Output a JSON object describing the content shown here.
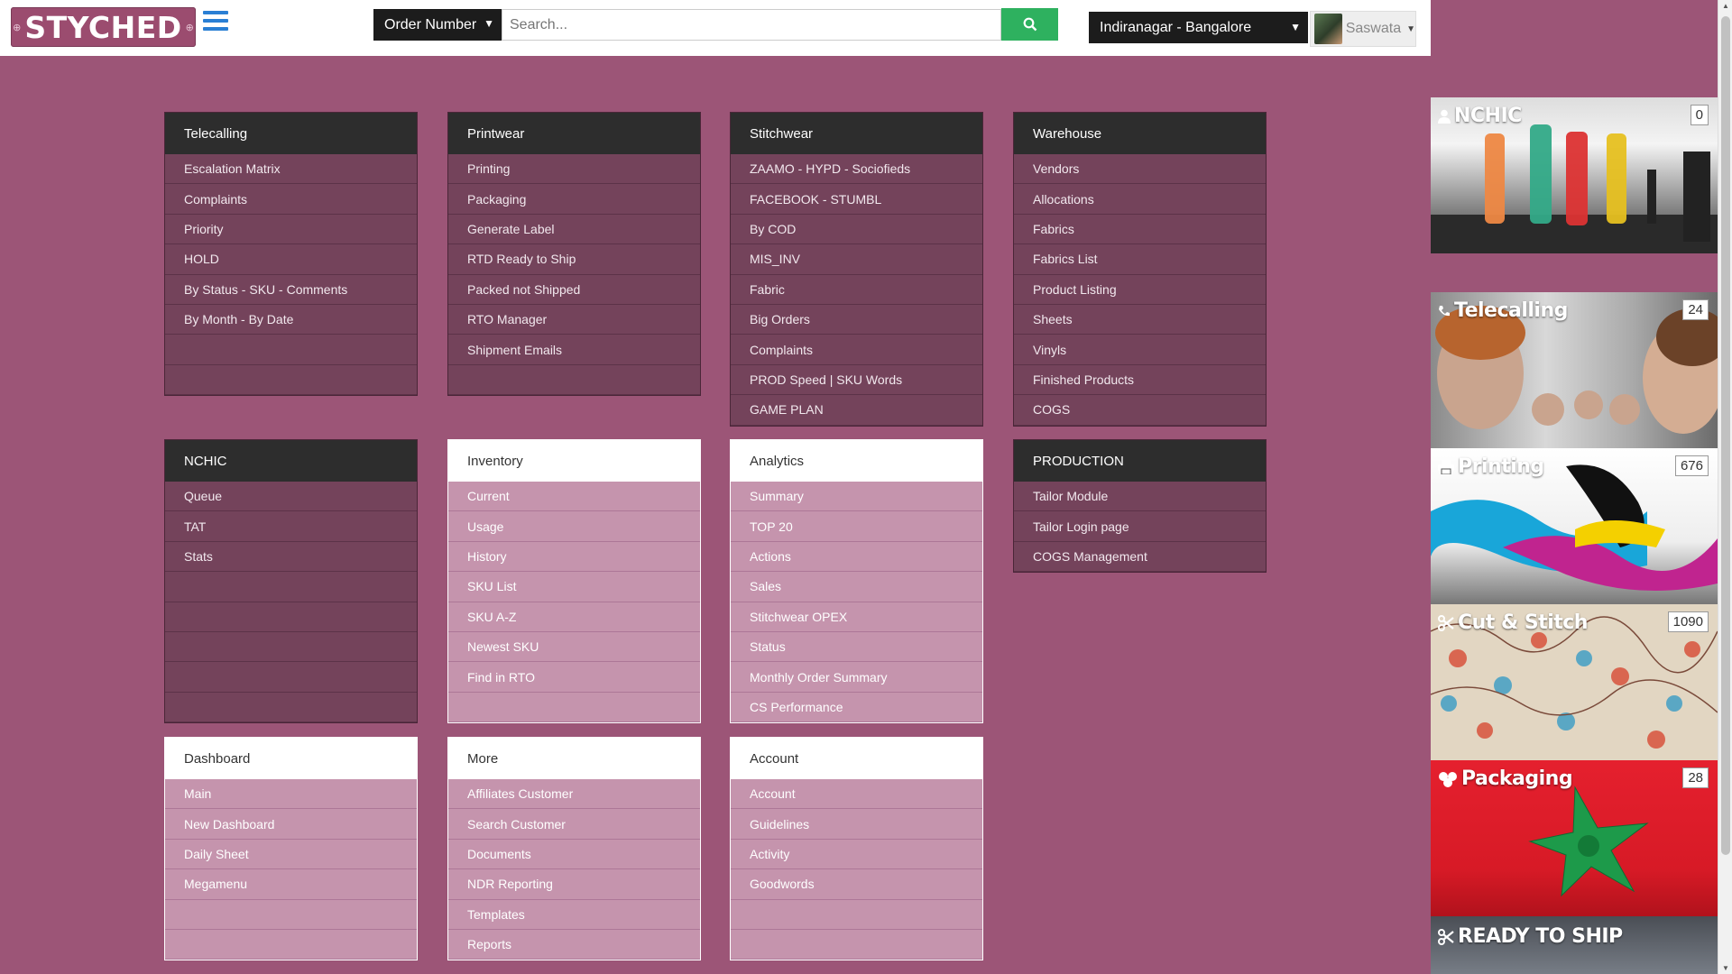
{
  "header": {
    "logo_text": "STYCHED",
    "order_select": "Order Number",
    "search_placeholder": "Search...",
    "branch_select": "Indiranagar - Bangalore",
    "user_name": "Saswata"
  },
  "panels": [
    {
      "title": "Telecalling",
      "theme": "dark",
      "items": [
        "Escalation Matrix",
        "Complaints",
        "Priority",
        "HOLD",
        "By Status - SKU - Comments",
        "By Month - By Date",
        "",
        ""
      ]
    },
    {
      "title": "Printwear",
      "theme": "dark",
      "items": [
        "Printing",
        "Packaging",
        "Generate Label",
        "RTD Ready to Ship",
        "Packed not Shipped",
        "RTO Manager",
        "Shipment Emails",
        ""
      ]
    },
    {
      "title": "Stitchwear",
      "theme": "dark",
      "items": [
        "ZAAMO - HYPD - Sociofieds",
        "FACEBOOK - STUMBL",
        "By COD",
        "MIS_INV",
        "Fabric",
        "Big Orders",
        "Complaints",
        "PROD Speed | SKU Words",
        "GAME PLAN"
      ]
    },
    {
      "title": "Warehouse",
      "theme": "dark",
      "items": [
        "Vendors",
        "Allocations",
        "Fabrics",
        "Fabrics List",
        "Product Listing",
        "Sheets",
        "Vinyls",
        "Finished Products",
        "COGS"
      ]
    },
    {
      "title": "NCHIC",
      "theme": "dark",
      "items": [
        "Queue",
        "TAT",
        "Stats",
        "",
        "",
        "",
        "",
        ""
      ]
    },
    {
      "title": "Inventory",
      "theme": "light",
      "items": [
        "Current",
        "Usage",
        "History",
        "SKU List",
        "SKU A-Z",
        "Newest SKU",
        "Find in RTO",
        ""
      ]
    },
    {
      "title": "Analytics",
      "theme": "light",
      "items": [
        "Summary",
        "TOP 20",
        "Actions",
        "Sales",
        "Stitchwear OPEX",
        "Status",
        "Monthly Order Summary",
        "CS Performance"
      ]
    },
    {
      "title": "PRODUCTION",
      "theme": "dark",
      "items": [
        "Tailor Module",
        "Tailor Login page",
        "COGS Management"
      ]
    },
    {
      "title": "Dashboard",
      "theme": "light",
      "items": [
        "Main",
        "New Dashboard",
        "Daily Sheet",
        "Megamenu",
        "",
        ""
      ]
    },
    {
      "title": "More",
      "theme": "light",
      "items": [
        "Affiliates Customer",
        "Search Customer",
        "Documents",
        "NDR Reporting",
        "Templates",
        "Reports"
      ]
    },
    {
      "title": "Account",
      "theme": "light",
      "items": [
        "Account",
        "Guidelines",
        "Activity",
        "Goodwords",
        "",
        ""
      ]
    }
  ],
  "tiles": [
    {
      "title": "NCHIC",
      "count": "0",
      "icon": "user-icon"
    },
    {
      "title": "Telecalling",
      "count": "24",
      "icon": "phone-icon"
    },
    {
      "title": "Printing",
      "count": "676",
      "icon": "printer-icon"
    },
    {
      "title": "Cut & Stitch",
      "count": "1090",
      "icon": "scissors-icon"
    },
    {
      "title": "Packaging",
      "count": "28",
      "icon": "gift-icon"
    },
    {
      "title": "READY TO SHIP",
      "count": "",
      "icon": "scissors-icon"
    }
  ],
  "colors": {
    "page_bg": "#9c5577",
    "search_button": "#2eb15f",
    "menu_icon": "#2a7fd4"
  }
}
